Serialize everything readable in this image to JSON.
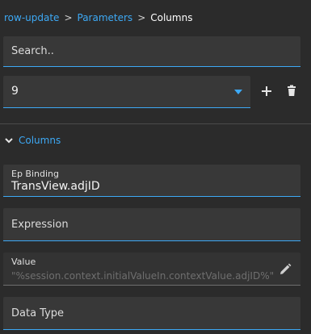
{
  "breadcrumb": {
    "items": [
      "row-update",
      "Parameters"
    ],
    "separator": ">",
    "current": "Columns"
  },
  "search": {
    "placeholder": "Search.."
  },
  "selector": {
    "value": "9"
  },
  "actions": {
    "add_icon": "plus-icon",
    "delete_icon": "trash-icon"
  },
  "section": {
    "label": "Columns",
    "icon": "chevron-down-icon"
  },
  "fields": {
    "ep_binding": {
      "label": "Ep Binding",
      "value": "TransView.adjID"
    },
    "expression": {
      "placeholder": "Expression"
    },
    "value": {
      "label": "Value",
      "value": "\"%session.context.initialValueIn.contextValue.adjID%\"",
      "icon": "pencil-icon"
    },
    "data_type": {
      "placeholder": "Data Type"
    }
  },
  "colors": {
    "accent": "#3da9f5",
    "background": "#2b2b2b",
    "field": "#383838"
  }
}
